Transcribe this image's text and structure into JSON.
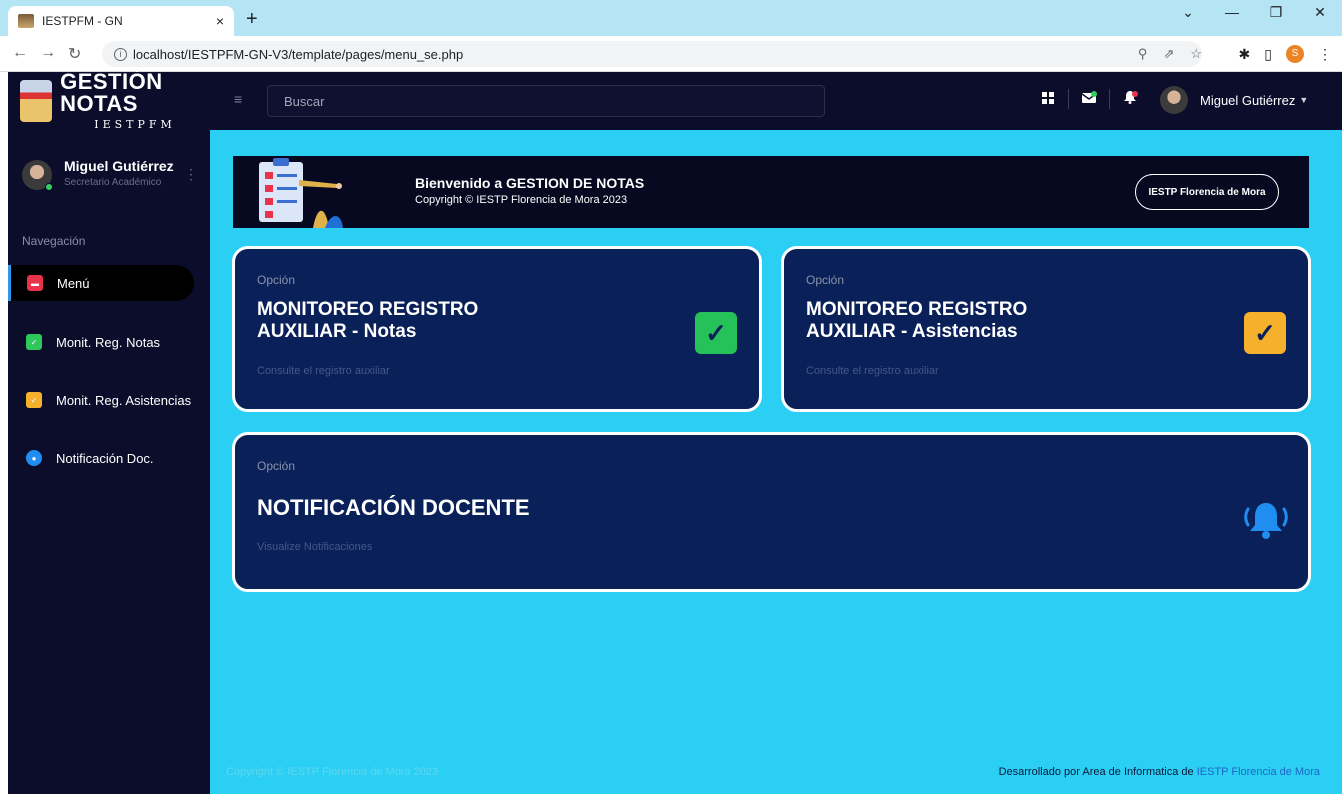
{
  "browser": {
    "tab_title": "IESTPFM - GN",
    "tab_close": "×",
    "new_tab": "+",
    "url": "localhost/IESTPFM-GN-V3/template/pages/menu_se.php",
    "profile_initial": "S"
  },
  "header": {
    "logo_title": "GESTIÓN NOTAS",
    "logo_subtitle": "IESTPFM",
    "search_placeholder": "Buscar",
    "user_name": "Miguel Gutiérrez"
  },
  "sidebar": {
    "user_name": "Miguel Gutiérrez",
    "user_role": "Secretario Académico",
    "nav_title": "Navegación",
    "items": [
      {
        "label": "Menú",
        "icon": "folder-icon",
        "color": "#e8334a",
        "active": true
      },
      {
        "label": "Monit. Reg. Notas",
        "icon": "comment-check-icon",
        "color": "#2ec85a",
        "active": false
      },
      {
        "label": "Monit. Reg. Asistencias",
        "icon": "comment-check-icon",
        "color": "#f5b12c",
        "active": false
      },
      {
        "label": "Notificación Doc.",
        "icon": "bell-icon",
        "color": "#1f8ef0",
        "active": false
      }
    ]
  },
  "banner": {
    "title": "Bienvenido a GESTION DE NOTAS",
    "subtitle": "Copyright © IESTP Florencia de Mora 2023",
    "button": "IESTP Florencia de Mora"
  },
  "cards": [
    {
      "label": "Opción",
      "title_line1": "MONITOREO REGISTRO",
      "title_line2": "AUXILIAR - Notas",
      "desc": "Consulte el registro auxiliar",
      "icon": "comment-check-icon",
      "color": "#25c25a"
    },
    {
      "label": "Opción",
      "title_line1": "MONITOREO REGISTRO",
      "title_line2": "AUXILIAR - Asistencias",
      "desc": "Consulte el registro auxiliar",
      "icon": "comment-check-icon",
      "color": "#f5b12c"
    },
    {
      "label": "Opción",
      "title_line1": "NOTIFICACIÓN DOCENTE",
      "desc": "Visualize Notificaciones",
      "icon": "bell-ring-icon",
      "color": "#1f8ef0"
    }
  ],
  "footer": {
    "left": "Copyright © IESTP Florencia de Mora 2023",
    "right_prefix": "Desarrollado por Area de Informatica de ",
    "right_link": "IESTP Florencia de Mora"
  }
}
